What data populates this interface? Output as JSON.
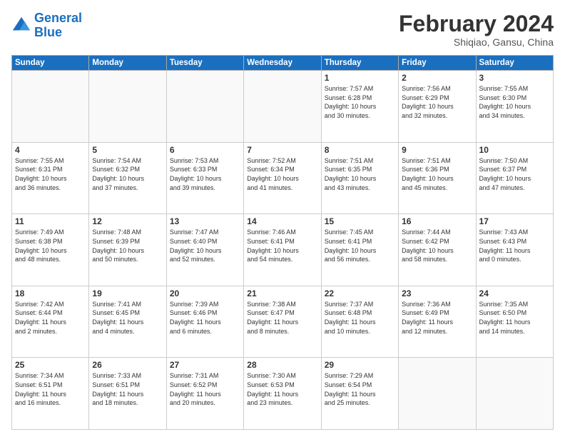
{
  "logo": {
    "line1": "General",
    "line2": "Blue"
  },
  "header": {
    "title": "February 2024",
    "subtitle": "Shiqiao, Gansu, China"
  },
  "weekdays": [
    "Sunday",
    "Monday",
    "Tuesday",
    "Wednesday",
    "Thursday",
    "Friday",
    "Saturday"
  ],
  "weeks": [
    [
      {
        "day": "",
        "info": ""
      },
      {
        "day": "",
        "info": ""
      },
      {
        "day": "",
        "info": ""
      },
      {
        "day": "",
        "info": ""
      },
      {
        "day": "1",
        "info": "Sunrise: 7:57 AM\nSunset: 6:28 PM\nDaylight: 10 hours\nand 30 minutes."
      },
      {
        "day": "2",
        "info": "Sunrise: 7:56 AM\nSunset: 6:29 PM\nDaylight: 10 hours\nand 32 minutes."
      },
      {
        "day": "3",
        "info": "Sunrise: 7:55 AM\nSunset: 6:30 PM\nDaylight: 10 hours\nand 34 minutes."
      }
    ],
    [
      {
        "day": "4",
        "info": "Sunrise: 7:55 AM\nSunset: 6:31 PM\nDaylight: 10 hours\nand 36 minutes."
      },
      {
        "day": "5",
        "info": "Sunrise: 7:54 AM\nSunset: 6:32 PM\nDaylight: 10 hours\nand 37 minutes."
      },
      {
        "day": "6",
        "info": "Sunrise: 7:53 AM\nSunset: 6:33 PM\nDaylight: 10 hours\nand 39 minutes."
      },
      {
        "day": "7",
        "info": "Sunrise: 7:52 AM\nSunset: 6:34 PM\nDaylight: 10 hours\nand 41 minutes."
      },
      {
        "day": "8",
        "info": "Sunrise: 7:51 AM\nSunset: 6:35 PM\nDaylight: 10 hours\nand 43 minutes."
      },
      {
        "day": "9",
        "info": "Sunrise: 7:51 AM\nSunset: 6:36 PM\nDaylight: 10 hours\nand 45 minutes."
      },
      {
        "day": "10",
        "info": "Sunrise: 7:50 AM\nSunset: 6:37 PM\nDaylight: 10 hours\nand 47 minutes."
      }
    ],
    [
      {
        "day": "11",
        "info": "Sunrise: 7:49 AM\nSunset: 6:38 PM\nDaylight: 10 hours\nand 48 minutes."
      },
      {
        "day": "12",
        "info": "Sunrise: 7:48 AM\nSunset: 6:39 PM\nDaylight: 10 hours\nand 50 minutes."
      },
      {
        "day": "13",
        "info": "Sunrise: 7:47 AM\nSunset: 6:40 PM\nDaylight: 10 hours\nand 52 minutes."
      },
      {
        "day": "14",
        "info": "Sunrise: 7:46 AM\nSunset: 6:41 PM\nDaylight: 10 hours\nand 54 minutes."
      },
      {
        "day": "15",
        "info": "Sunrise: 7:45 AM\nSunset: 6:41 PM\nDaylight: 10 hours\nand 56 minutes."
      },
      {
        "day": "16",
        "info": "Sunrise: 7:44 AM\nSunset: 6:42 PM\nDaylight: 10 hours\nand 58 minutes."
      },
      {
        "day": "17",
        "info": "Sunrise: 7:43 AM\nSunset: 6:43 PM\nDaylight: 11 hours\nand 0 minutes."
      }
    ],
    [
      {
        "day": "18",
        "info": "Sunrise: 7:42 AM\nSunset: 6:44 PM\nDaylight: 11 hours\nand 2 minutes."
      },
      {
        "day": "19",
        "info": "Sunrise: 7:41 AM\nSunset: 6:45 PM\nDaylight: 11 hours\nand 4 minutes."
      },
      {
        "day": "20",
        "info": "Sunrise: 7:39 AM\nSunset: 6:46 PM\nDaylight: 11 hours\nand 6 minutes."
      },
      {
        "day": "21",
        "info": "Sunrise: 7:38 AM\nSunset: 6:47 PM\nDaylight: 11 hours\nand 8 minutes."
      },
      {
        "day": "22",
        "info": "Sunrise: 7:37 AM\nSunset: 6:48 PM\nDaylight: 11 hours\nand 10 minutes."
      },
      {
        "day": "23",
        "info": "Sunrise: 7:36 AM\nSunset: 6:49 PM\nDaylight: 11 hours\nand 12 minutes."
      },
      {
        "day": "24",
        "info": "Sunrise: 7:35 AM\nSunset: 6:50 PM\nDaylight: 11 hours\nand 14 minutes."
      }
    ],
    [
      {
        "day": "25",
        "info": "Sunrise: 7:34 AM\nSunset: 6:51 PM\nDaylight: 11 hours\nand 16 minutes."
      },
      {
        "day": "26",
        "info": "Sunrise: 7:33 AM\nSunset: 6:51 PM\nDaylight: 11 hours\nand 18 minutes."
      },
      {
        "day": "27",
        "info": "Sunrise: 7:31 AM\nSunset: 6:52 PM\nDaylight: 11 hours\nand 20 minutes."
      },
      {
        "day": "28",
        "info": "Sunrise: 7:30 AM\nSunset: 6:53 PM\nDaylight: 11 hours\nand 23 minutes."
      },
      {
        "day": "29",
        "info": "Sunrise: 7:29 AM\nSunset: 6:54 PM\nDaylight: 11 hours\nand 25 minutes."
      },
      {
        "day": "",
        "info": ""
      },
      {
        "day": "",
        "info": ""
      }
    ]
  ]
}
